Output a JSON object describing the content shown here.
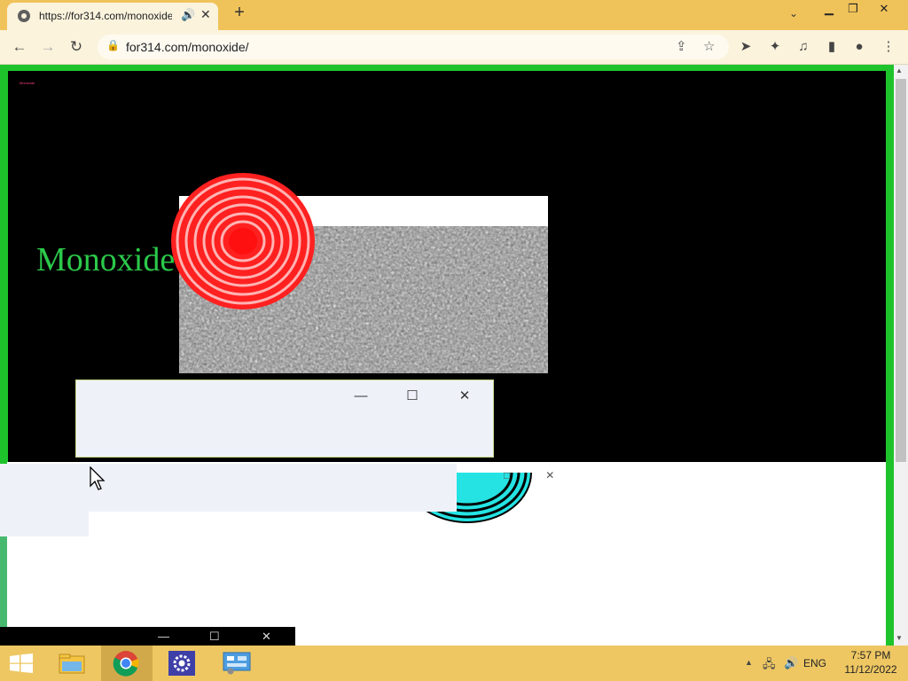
{
  "browser": {
    "tab_title": "https://for314.com/monoxide/",
    "url": "for314.com/monoxide/",
    "icons": {
      "audio": "speaker-icon",
      "close": "close-icon",
      "new_tab": "plus-icon"
    },
    "window_controls": [
      "minimize",
      "restore",
      "close"
    ]
  },
  "page": {
    "tiny_title": "Monoxide",
    "heading": "Monoxide",
    "colors": {
      "frame": "#1ec32c",
      "heading": "#2bc94a",
      "target": "#ff1a1a",
      "ring": "#22e0e0"
    }
  },
  "taskbar": {
    "apps": [
      "start-icon",
      "file-explorer-icon",
      "chrome-icon",
      "settings-icon",
      "control-panel-icon"
    ],
    "language": "ENG",
    "time": "7:57 PM",
    "date": "11/12/2022"
  }
}
